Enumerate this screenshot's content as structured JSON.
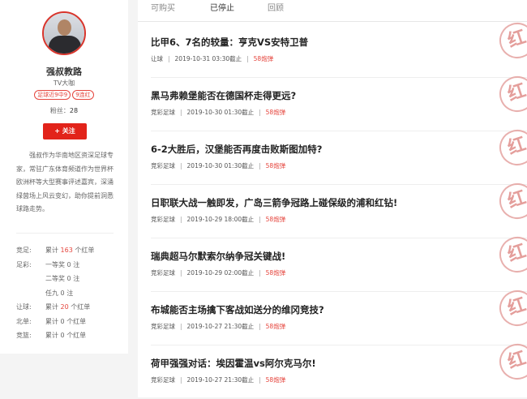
{
  "profile": {
    "name": "强叔教路",
    "subtitle": "TV大咖",
    "tags": [
      "足球近9中9",
      "9连红"
    ],
    "fans_label": "粉丝：",
    "fans_count": "28",
    "follow_label": "+ 关注",
    "bio": "强叔作为华南地区资深足球专家，常驻广东体育频道作为世界杯欧洲杯等大型赛事评述嘉宾，深涌绿茵场上风云变幻，助你提前洞悉球路走势。",
    "stats": [
      {
        "label": "竞足:",
        "prefix": "累计",
        "value": "163",
        "suffix": "个红单"
      },
      {
        "label": "足彩:",
        "prefix": "一等奖",
        "value": "0",
        "suffix": "注"
      },
      {
        "label": "",
        "prefix": "二等奖",
        "value": "0",
        "suffix": "注"
      },
      {
        "label": "",
        "prefix": "任九",
        "value": "0",
        "suffix": "注"
      },
      {
        "label": "让球:",
        "prefix": "累计",
        "value": "20",
        "suffix": "个红单"
      },
      {
        "label": "北单:",
        "prefix": "累计",
        "value": "0",
        "suffix": "个红单"
      },
      {
        "label": "竞篮:",
        "prefix": "累计",
        "value": "0",
        "suffix": "个红单"
      }
    ]
  },
  "tabs": [
    {
      "label": "可购买",
      "active": false
    },
    {
      "label": "已停止",
      "active": true
    },
    {
      "label": "回顾",
      "active": false
    }
  ],
  "articles": [
    {
      "title": "比甲6、7名的较量：亨克VS安特卫普",
      "category": "让球",
      "time": "2019-10-31 03:30截止",
      "price": "58炮弹",
      "stamp": "红"
    },
    {
      "title": "黑马弗赖堡能否在德国杯走得更远?",
      "category": "竞彩足球",
      "time": "2019-10-30 01:30截止",
      "price": "58炮弹",
      "stamp": "红"
    },
    {
      "title": "6-2大胜后，汉堡能否再度击败斯图加特?",
      "category": "竞彩足球",
      "time": "2019-10-30 01:30截止",
      "price": "58炮弹",
      "stamp": "红"
    },
    {
      "title": "日职联大战一触即发，广岛三箭争冠路上碰保级的浦和红钻!",
      "category": "竞彩足球",
      "time": "2019-10-29 18:00截止",
      "price": "58炮弹",
      "stamp": "红"
    },
    {
      "title": "瑞典超马尔默索尔纳争冠关键战!",
      "category": "竞彩足球",
      "time": "2019-10-29 02:00截止",
      "price": "58炮弹",
      "stamp": "红"
    },
    {
      "title": "布城能否主场擒下客战如送分的维冈竞技?",
      "category": "竞彩足球",
      "time": "2019-10-27 21:30截止",
      "price": "58炮弹",
      "stamp": "红"
    },
    {
      "title": "荷甲强强对话：埃因霍温vs阿尔克马尔!",
      "category": "竞彩足球",
      "time": "2019-10-27 21:30截止",
      "price": "58炮弹",
      "stamp": "红"
    }
  ],
  "colors": {
    "accent": "#e2231a",
    "stamp": "#e5a3a0"
  }
}
